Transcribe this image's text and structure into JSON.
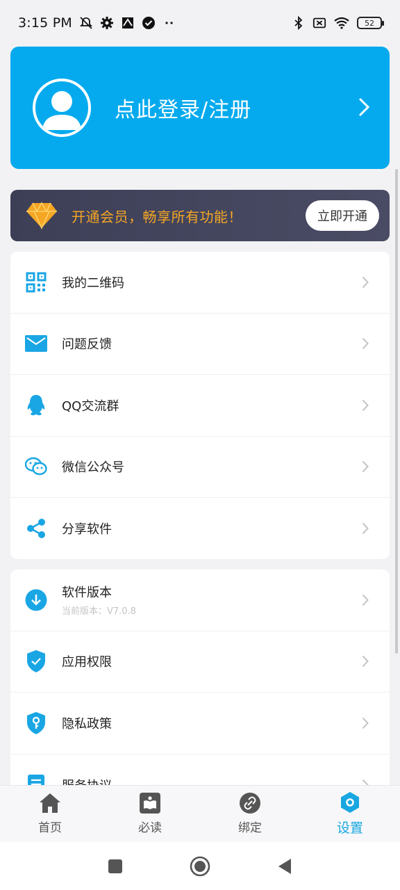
{
  "status_bar": {
    "time": "3:15 PM",
    "battery": "52",
    "left_icons": [
      "mute-icon",
      "gear-icon",
      "app-icon",
      "check-circle-icon",
      "more-dots-icon"
    ],
    "right_icons": [
      "bluetooth-icon",
      "sim-off-icon",
      "wifi-icon",
      "battery-icon"
    ]
  },
  "login": {
    "text": "点此登录/注册"
  },
  "vip": {
    "text": "开通会员，畅享所有功能！",
    "button": "立即开通"
  },
  "menu_group_1": [
    {
      "label": "我的二维码",
      "icon": "qr-code-icon"
    },
    {
      "label": "问题反馈",
      "icon": "mail-icon"
    },
    {
      "label": "QQ交流群",
      "icon": "qq-penguin-icon"
    },
    {
      "label": "微信公众号",
      "icon": "wechat-icon"
    },
    {
      "label": "分享软件",
      "icon": "share-icon"
    }
  ],
  "menu_group_2": [
    {
      "label": "软件版本",
      "sub": "当前版本：V7.0.8",
      "icon": "download-icon"
    },
    {
      "label": "应用权限",
      "icon": "shield-check-icon"
    },
    {
      "label": "隐私政策",
      "icon": "shield-key-icon"
    },
    {
      "label": "服务协议",
      "icon": "document-icon"
    }
  ],
  "tabs": [
    {
      "label": "首页",
      "icon": "home-icon",
      "active": false
    },
    {
      "label": "必读",
      "icon": "book-icon",
      "active": false
    },
    {
      "label": "绑定",
      "icon": "link-icon",
      "active": false
    },
    {
      "label": "设置",
      "icon": "settings-hex-icon",
      "active": true
    }
  ],
  "colors": {
    "primary": "#05aaee",
    "vip_text": "#f5a623",
    "vip_bg": "#3d3f57",
    "active_tab": "#18a7e0"
  }
}
